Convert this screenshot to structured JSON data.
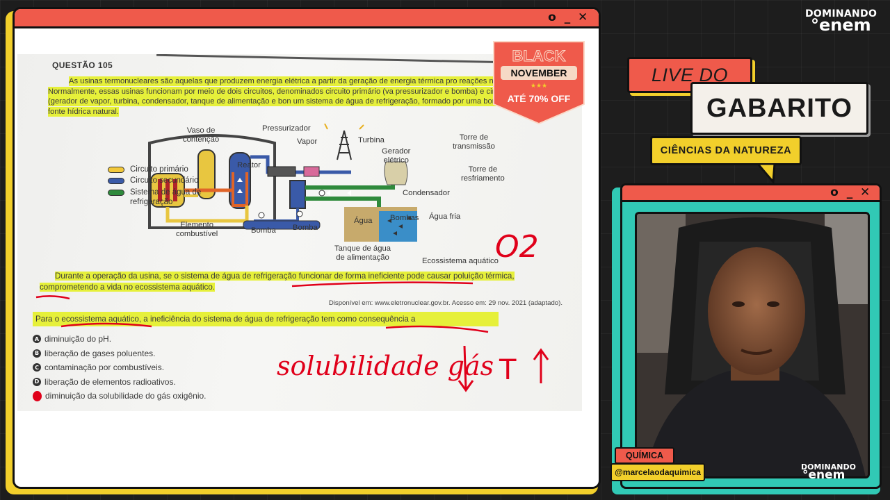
{
  "branding": {
    "logo_top": "DOMINANDO",
    "logo_bottom": "°enem",
    "live_label": "LIVE DO",
    "gabarito_label": "GABARITO",
    "subject_label": "CIÊNCIAS DA NATUREZA",
    "cam_logo_top": "DOMINANDO",
    "cam_logo_bottom": "°enem",
    "tag_subject": "QUÍMICA",
    "tag_user": "@marcelaodaquimica"
  },
  "window_controls": {
    "restore": "o",
    "minimize": "_",
    "close": "✕"
  },
  "promo": {
    "line1": "BLACK",
    "line2": "NOVEMBER",
    "stars": "★★★",
    "offer": "ATÉ 70% OFF"
  },
  "question": {
    "title": "QUESTÃO 105",
    "paragraph1": "As usinas termonucleares são aquelas que produzem energia elétrica a partir da geração de energia térmica pro reações nucleares. Normalmente, essas usinas funcionam por meio de dois circuitos, denominados circuito primário (va pressurizador e bomba) e circuito secundário (gerador de vapor, turbina, condensador, tanque de alimentação e bon um sistema de água de refrigeração, formado por uma bomba ligada a uma fonte hídrica natural.",
    "paragraph2": "Durante a operação da usina, se o sistema de água de refrigeração funcionar de forma ineficiente pode causar poluição térmica, comprometendo a vida no ecossistema aquático.",
    "source": "Disponível em: www.eletronuclear.gov.br. Acesso em: 29 nov. 2021 (adaptado).",
    "stem": "Para o ecossistema aquático, a ineficiência do sistema de água de refrigeração tem como consequência a",
    "options": [
      {
        "letter": "A",
        "text": "diminuição do pH."
      },
      {
        "letter": "B",
        "text": "liberação de gases poluentes."
      },
      {
        "letter": "C",
        "text": "contaminação por combustíveis."
      },
      {
        "letter": "D",
        "text": "liberação de elementos radioativos."
      },
      {
        "letter": "E",
        "text": "diminuição da solubilidade do gás oxigênio."
      }
    ]
  },
  "diagram": {
    "labels": {
      "vaso": "Vaso de\ncontenção",
      "pressurizador": "Pressurizador",
      "vapor": "Vapor",
      "turbina": "Turbina",
      "gerador": "Gerador\nelétrico",
      "torre_transmissao": "Torre de\ntransmissão",
      "reator": "Reator",
      "torre_resfriamento": "Torre de\nresfriamento",
      "condensador": "Condensador",
      "elemento": "Elemento\ncombustível",
      "bomba1": "Bomba",
      "bomba2": "Bomba",
      "agua": "Água",
      "bombas": "Bombas",
      "agua_fria": "Água fria",
      "tanque": "Tanque de água\nde alimentação",
      "ecossistema": "Ecossistema aquático"
    },
    "legend": [
      {
        "label": "Circuito primário",
        "color": "#f2c83a"
      },
      {
        "label": "Circuito secundário",
        "color": "#3a5aa8"
      },
      {
        "label": "Sistema de água de\nrefrigeração",
        "color": "#2f8a3c"
      }
    ]
  },
  "annotations": {
    "o2": "O2",
    "solubilidade": "solubilidade gás",
    "temp": "T"
  }
}
